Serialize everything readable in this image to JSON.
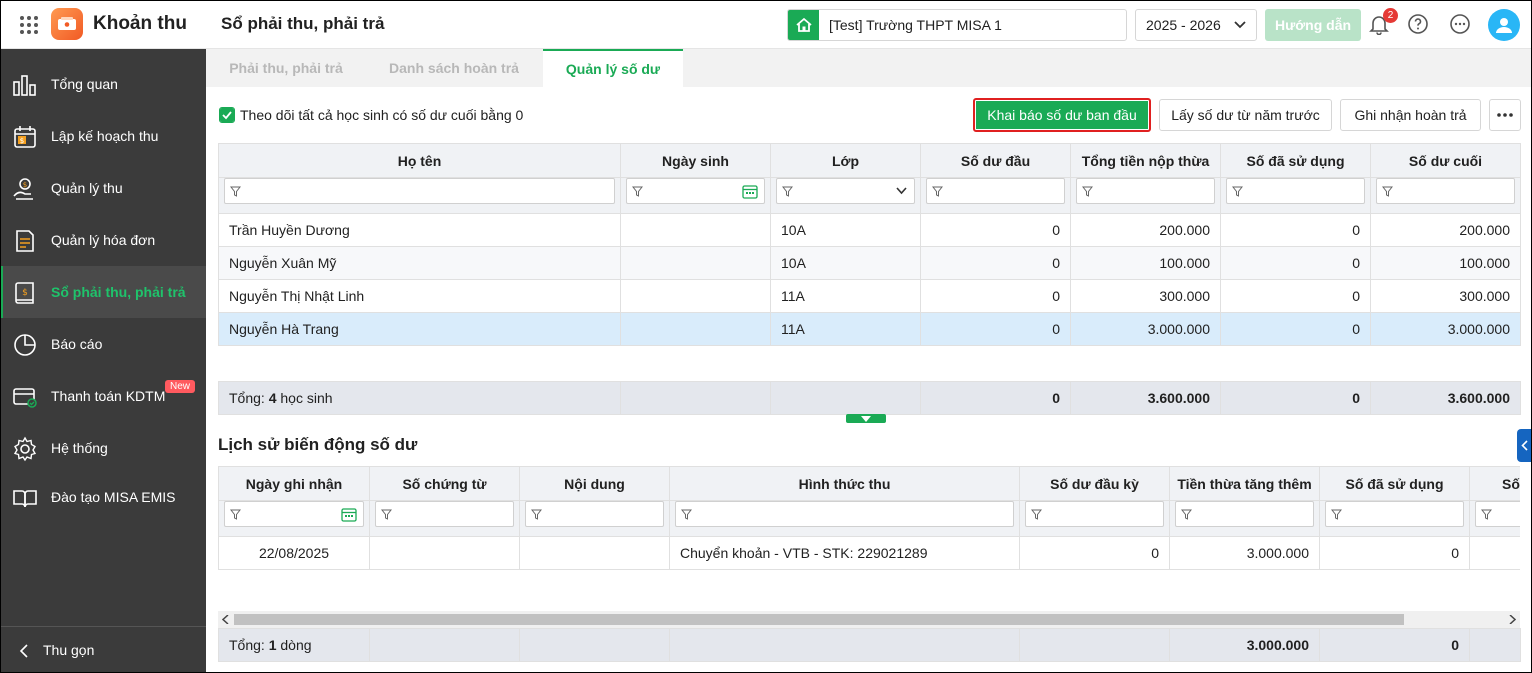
{
  "header": {
    "app_name": "Khoản thu",
    "page_title": "Sổ phải thu, phải trả",
    "school": "[Test] Trường THPT MISA 1",
    "school_year": "2025 - 2026",
    "guide_label": "Hướng dẫn",
    "notification_count": "2",
    "icons": [
      "apps-grid-icon",
      "app-logo-icon",
      "home-icon",
      "chevron-down-icon",
      "bell-icon",
      "help-icon",
      "more-icon",
      "user-avatar-icon"
    ]
  },
  "sidebar": {
    "items": [
      {
        "label": "Tổng quan",
        "icon": "dashboard-icon"
      },
      {
        "label": "Lập kế hoạch thu",
        "icon": "calendar-money-icon"
      },
      {
        "label": "Quản lý thu",
        "icon": "money-hand-icon"
      },
      {
        "label": "Quản lý hóa đơn",
        "icon": "invoice-icon"
      },
      {
        "label": "Sổ phải thu, phải trả",
        "icon": "ledger-icon",
        "active": true
      },
      {
        "label": "Báo cáo",
        "icon": "pie-chart-icon"
      },
      {
        "label": "Thanh toán KDTM",
        "icon": "card-payment-icon",
        "badge": "New"
      },
      {
        "label": "Hệ thống",
        "icon": "gear-icon"
      },
      {
        "label": "Đào tạo MISA EMIS",
        "icon": "book-icon"
      }
    ],
    "collapse_label": "Thu gọn"
  },
  "tabs": [
    "Phải thu, phải trả",
    "Danh sách hoàn trả",
    "Quản lý số dư"
  ],
  "toolbar": {
    "checkbox_label": "Theo dõi tất cả học sinh có số dư cuối bằng 0",
    "checkbox_checked": true,
    "btn_declare": "Khai báo số dư ban đầu",
    "btn_prev_year": "Lấy số dư từ năm trước",
    "btn_refund": "Ghi nhận hoàn trả"
  },
  "balance_table": {
    "columns": [
      "Họ tên",
      "Ngày sinh",
      "Lớp",
      "Số dư đầu",
      "Tổng tiền nộp thừa",
      "Số đã sử dụng",
      "Số dư cuối"
    ],
    "rows": [
      [
        "Trần Huyền Dương",
        "",
        "10A",
        "0",
        "200.000",
        "0",
        "200.000"
      ],
      [
        "Nguyễn Xuân Mỹ",
        "",
        "10A",
        "0",
        "100.000",
        "0",
        "100.000"
      ],
      [
        "Nguyễn Thị Nhật Linh",
        "",
        "11A",
        "0",
        "300.000",
        "0",
        "300.000"
      ],
      [
        "Nguyễn Hà Trang",
        "",
        "11A",
        "0",
        "3.000.000",
        "0",
        "3.000.000"
      ]
    ],
    "total": {
      "prefix": "Tổng:",
      "count": "4",
      "suffix": "học sinh",
      "values": [
        "0",
        "3.600.000",
        "0",
        "3.600.000"
      ]
    }
  },
  "history": {
    "title": "Lịch sử biến động số dư",
    "columns": [
      "Ngày ghi nhận",
      "Số chứng từ",
      "Nội dung",
      "Hình thức thu",
      "Số dư đầu kỳ",
      "Tiền thừa tăng thêm",
      "Số đã sử dụng",
      "Số"
    ],
    "rows": [
      [
        "22/08/2025",
        "",
        "",
        "Chuyển khoản - VTB - STK: 229021289",
        "0",
        "3.000.000",
        "0",
        ""
      ]
    ],
    "total": {
      "prefix": "Tổng:",
      "count": "1",
      "suffix": "dòng",
      "values": [
        "3.000.000",
        "0"
      ]
    }
  },
  "colors": {
    "accent": "#1aaa55",
    "sidebar_bg": "#3b3b3b",
    "selected_row": "#d9ecfb",
    "highlight_border": "#e02020"
  }
}
